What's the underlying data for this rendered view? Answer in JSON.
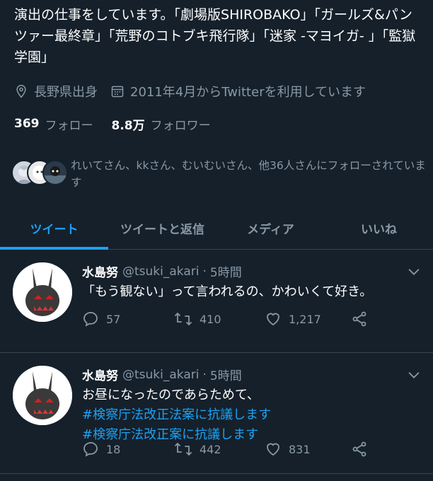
{
  "profile": {
    "bio": "演出の仕事をしています。「劇場版SHIROBAKO」「ガールズ&パンツァー最終章」「荒野のコトブキ飛行隊」「迷家 -マヨイガ- 」「監獄学園」",
    "location": "長野県出身",
    "joined": "2011年4月からTwitterを利用しています",
    "following_count": "369",
    "following_label": "フォロー",
    "followers_count": "8.8万",
    "followers_label": "フォロワー",
    "followed_by": "れいてさん、kkさん、むいむいさん、他36人さんにフォローされています"
  },
  "tabs": [
    {
      "label": "ツイート",
      "active": true
    },
    {
      "label": "ツイートと返信",
      "active": false
    },
    {
      "label": "メディア",
      "active": false
    },
    {
      "label": "いいね",
      "active": false
    }
  ],
  "tweets": [
    {
      "name": "水島努",
      "handle": "@tsuki_akari",
      "sep": "·",
      "time": "5時間",
      "text": "「もう観ない」って言われるの、かわいくて好き。",
      "replies": "57",
      "retweets": "410",
      "likes": "1,217"
    },
    {
      "name": "水島努",
      "handle": "@tsuki_akari",
      "sep": "·",
      "time": "5時間",
      "text": "お昼になったのであらためて、",
      "hashtags": [
        "#検察庁法改正法案に抗議します",
        "#検察庁法改正案に抗議します"
      ],
      "replies": "18",
      "retweets": "442",
      "likes": "831"
    }
  ],
  "colors": {
    "background": "#15202b",
    "accent": "#1da1f2",
    "secondary_text": "#8899a6",
    "divider": "#38444d"
  },
  "icons": [
    "location-icon",
    "calendar-icon",
    "reply-icon",
    "retweet-icon",
    "like-icon",
    "share-icon",
    "chevron-down-icon"
  ]
}
